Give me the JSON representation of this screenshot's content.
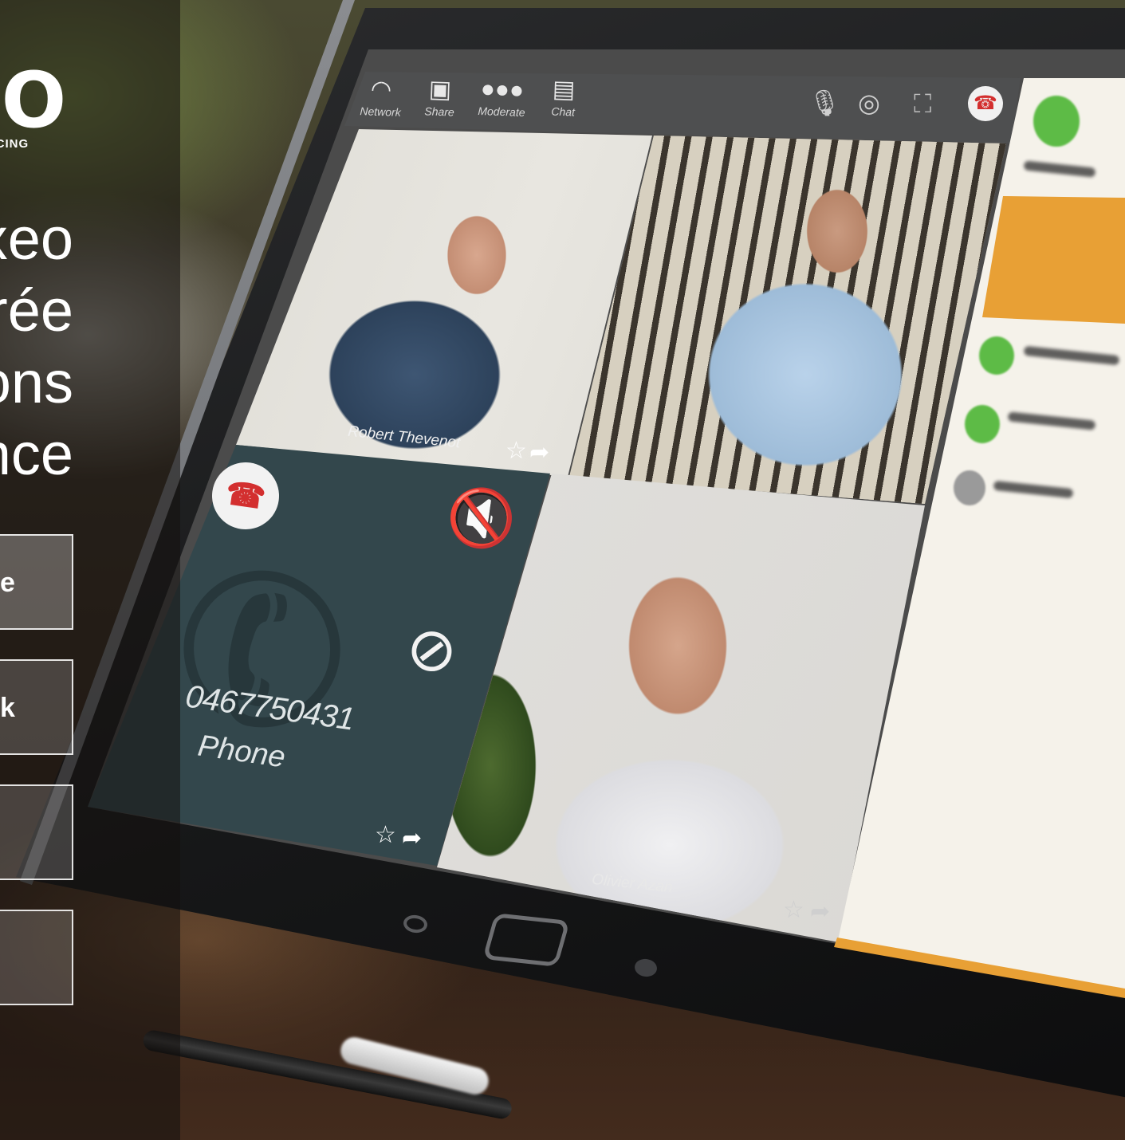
{
  "brand": {
    "logo_text": "EO",
    "logo_subtitle": "RENCING"
  },
  "headline": {
    "lines": [
      "xeo",
      "rée",
      "ons",
      "nce"
    ]
  },
  "side_menu": {
    "items": [
      {
        "label": "e"
      },
      {
        "label": "k"
      },
      {
        "label": ""
      },
      {
        "label": ""
      }
    ]
  },
  "app": {
    "toolbar": {
      "items": [
        {
          "label": "Network",
          "icon": "network-icon"
        },
        {
          "label": "Share",
          "icon": "share-icon"
        },
        {
          "label": "Moderate",
          "icon": "moderate-icon"
        },
        {
          "label": "Chat",
          "icon": "chat-icon"
        }
      ],
      "right_icons": [
        "microphone-icon",
        "webcam-icon",
        "fullscreen-icon",
        "hangup-icon"
      ]
    },
    "participants": [
      {
        "name": "Robert Thevenot"
      },
      {
        "name": "Olivier Azan"
      }
    ],
    "phone_tile": {
      "number": "0467750431",
      "label": "Phone"
    }
  },
  "colors": {
    "accent": "#e8a035",
    "online": "#5dbb46",
    "hangup": "#d32f2f",
    "phone_tile": "#33474c"
  }
}
